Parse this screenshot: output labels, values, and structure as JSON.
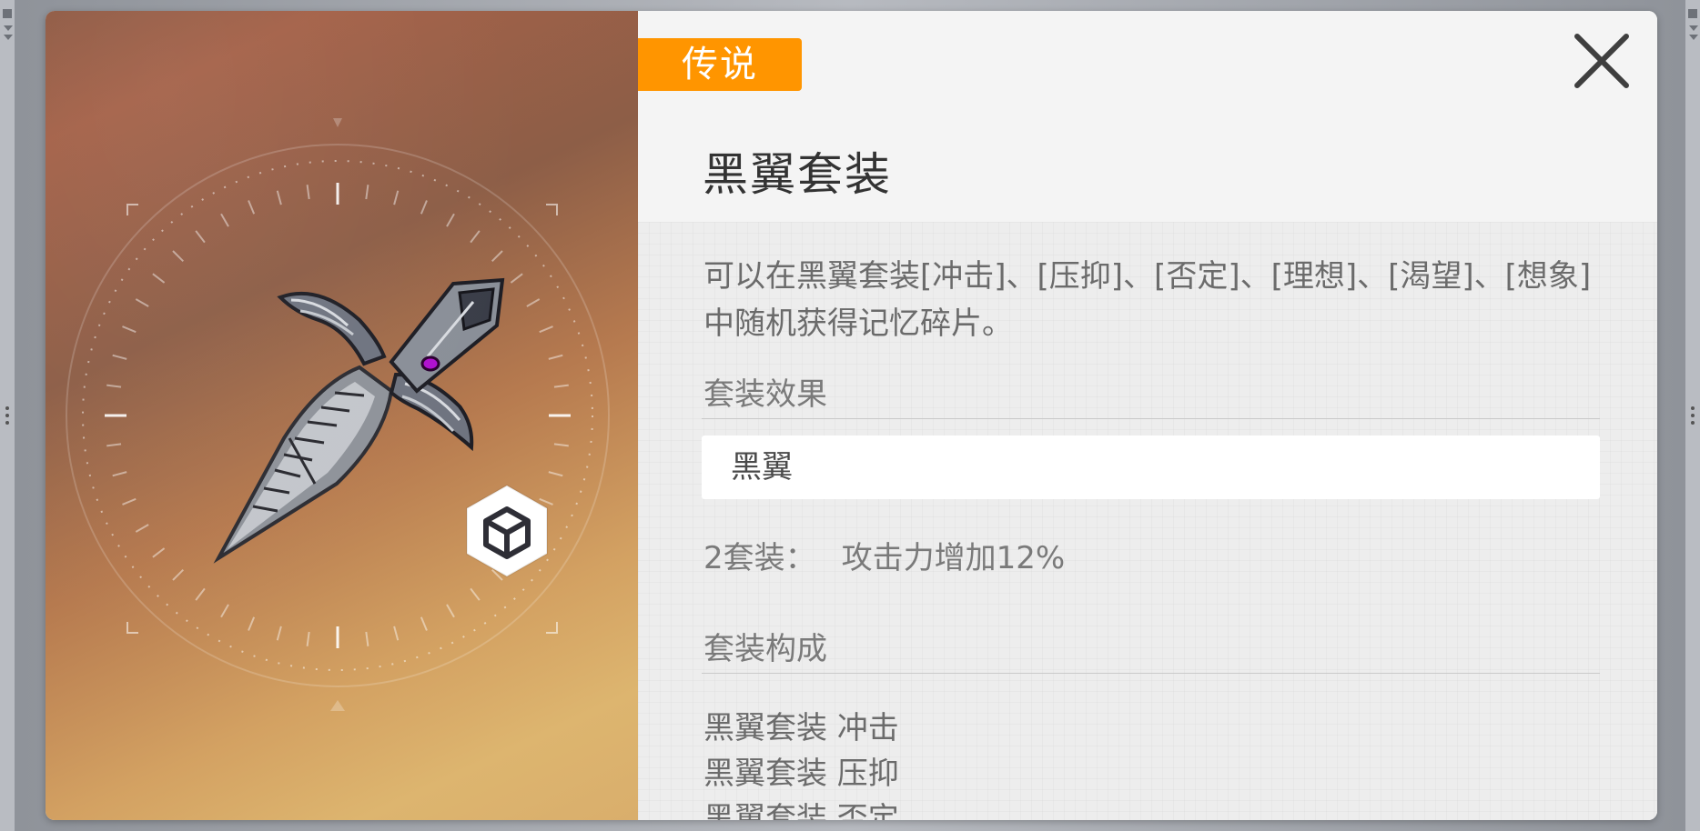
{
  "item": {
    "rarity": "传说",
    "title": "黑翼套装",
    "description": "可以在黑翼套装[冲击]、[压抑]、[否定]、[理想]、[渴望]、[想象]中随机获得记忆碎片。",
    "type_icon": "cube-icon"
  },
  "set_effect": {
    "heading": "套装效果",
    "set_name": "黑翼",
    "bonus_label": "2套装：",
    "bonus_value": "攻击力增加12%"
  },
  "set_components": {
    "heading": "套装构成",
    "items": [
      "黑翼套装 冲击",
      "黑翼套装 压抑",
      "黑翼套装 否定"
    ]
  },
  "colors": {
    "rarity_badge": "#ff9500",
    "title_text": "#333333",
    "body_text": "#6b6b6b"
  },
  "icons": {
    "close": "close-icon",
    "item_art": "black-wing-dagger-icon"
  }
}
